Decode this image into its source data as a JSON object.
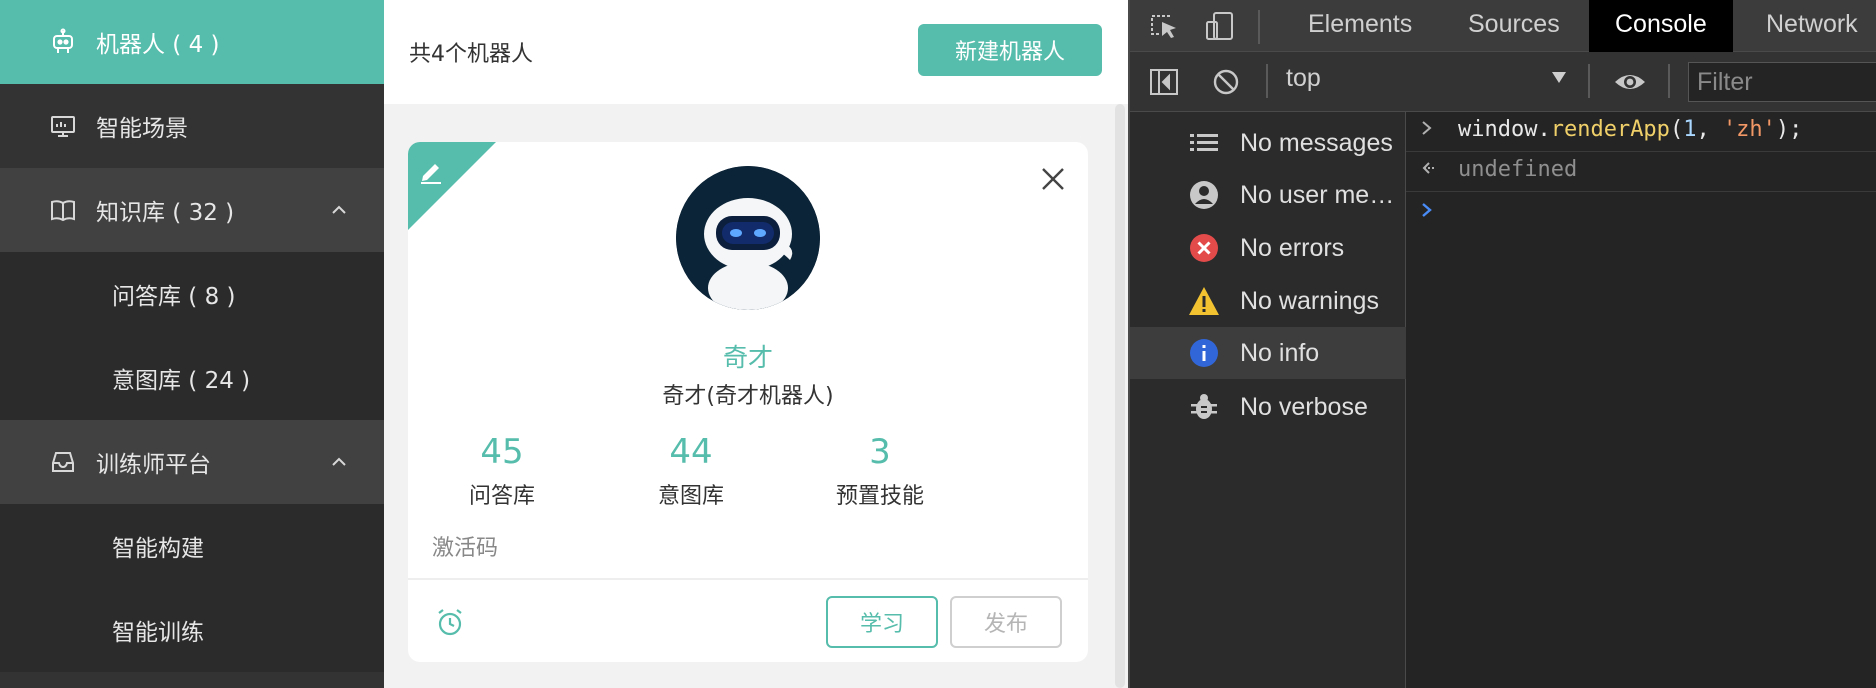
{
  "sidebar": {
    "items": [
      {
        "label": "机器人 ( 4 )",
        "icon": "robot-icon",
        "state": "active"
      },
      {
        "label": "智能场景",
        "icon": "monitor-icon"
      },
      {
        "label": "知识库 ( 32 )",
        "icon": "book-icon",
        "expanded": true
      },
      {
        "label": "问答库 ( 8 )",
        "sub": true
      },
      {
        "label": "意图库 ( 24 )",
        "sub": true
      },
      {
        "label": "训练师平台",
        "icon": "inbox-icon",
        "expanded": true
      },
      {
        "label": "智能构建",
        "sub": true
      },
      {
        "label": "智能训练",
        "sub": true
      }
    ]
  },
  "main": {
    "count_text": "共4个机器人",
    "new_button": "新建机器人",
    "card": {
      "name": "奇才",
      "subtitle": "奇才(奇才机器人)",
      "stats": [
        {
          "value": "45",
          "label": "问答库"
        },
        {
          "value": "44",
          "label": "意图库"
        },
        {
          "value": "3",
          "label": "预置技能"
        }
      ],
      "activation_label": "激活码",
      "learn_button": "学习",
      "publish_button": "发布"
    }
  },
  "devtools": {
    "tabs": [
      "Elements",
      "Sources",
      "Console",
      "Network"
    ],
    "active_tab": "Console",
    "context": "top",
    "filter_placeholder": "Filter",
    "message_types": [
      {
        "label": "No messages",
        "icon": "list-icon"
      },
      {
        "label": "No user me…",
        "icon": "user-icon"
      },
      {
        "label": "No errors",
        "icon": "error-icon"
      },
      {
        "label": "No warnings",
        "icon": "warning-icon"
      },
      {
        "label": "No info",
        "icon": "info-icon",
        "selected": true
      },
      {
        "label": "No verbose",
        "icon": "bug-icon"
      }
    ],
    "console": {
      "input": {
        "obj": "window.",
        "fn": "renderApp",
        "open": "(",
        "arg1": "1",
        "comma": ", ",
        "arg2": "'zh'",
        "close": ");"
      },
      "output": "undefined"
    }
  },
  "colors": {
    "accent": "#56bcab",
    "sidebar_bg": "#333333",
    "devtools_bg": "#242424"
  }
}
